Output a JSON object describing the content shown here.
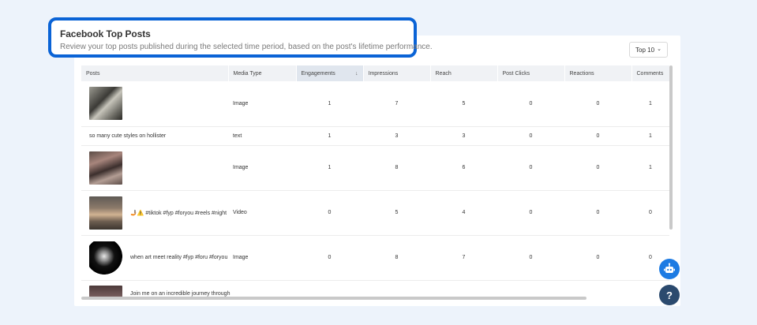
{
  "header": {
    "title": "Facebook Top Posts",
    "subtitle": "Review your top posts published during the selected time period, based on the post's lifetime performance."
  },
  "top_select": {
    "label": "Top 10"
  },
  "table": {
    "columns": [
      "Posts",
      "Media Type",
      "Engagements",
      "Impressions",
      "Reach",
      "Post Clicks",
      "Reactions",
      "Comments"
    ],
    "sorted_column": "Engagements",
    "rows": [
      {
        "caption": "",
        "media": "Image",
        "engagements": "1",
        "impressions": "7",
        "reach": "5",
        "post_clicks": "0",
        "reactions": "0",
        "comments": "1"
      },
      {
        "caption": "so many cute styles on hollister",
        "media": "text",
        "engagements": "1",
        "impressions": "3",
        "reach": "3",
        "post_clicks": "0",
        "reactions": "0",
        "comments": "1"
      },
      {
        "caption": "",
        "media": "Image",
        "engagements": "1",
        "impressions": "8",
        "reach": "6",
        "post_clicks": "0",
        "reactions": "0",
        "comments": "1"
      },
      {
        "caption": "🤳🏽⚠️ #tiktok #fyp #foryou #reels #night",
        "media": "Video",
        "engagements": "0",
        "impressions": "5",
        "reach": "4",
        "post_clicks": "0",
        "reactions": "0",
        "comments": "0"
      },
      {
        "caption": "when art meet reality #fyp #foru #foryou",
        "media": "Image",
        "engagements": "0",
        "impressions": "8",
        "reach": "7",
        "post_clicks": "0",
        "reactions": "0",
        "comments": "0"
      },
      {
        "caption": "Join me on an incredible journey through",
        "media": "",
        "engagements": "",
        "impressions": "",
        "reach": "",
        "post_clicks": "",
        "reactions": "",
        "comments": ""
      }
    ]
  },
  "fab": {
    "help_label": "?"
  },
  "colors": {
    "highlight_border": "#0a63d6",
    "bot_button": "#1d7be3",
    "help_button": "#2b4a6e"
  }
}
